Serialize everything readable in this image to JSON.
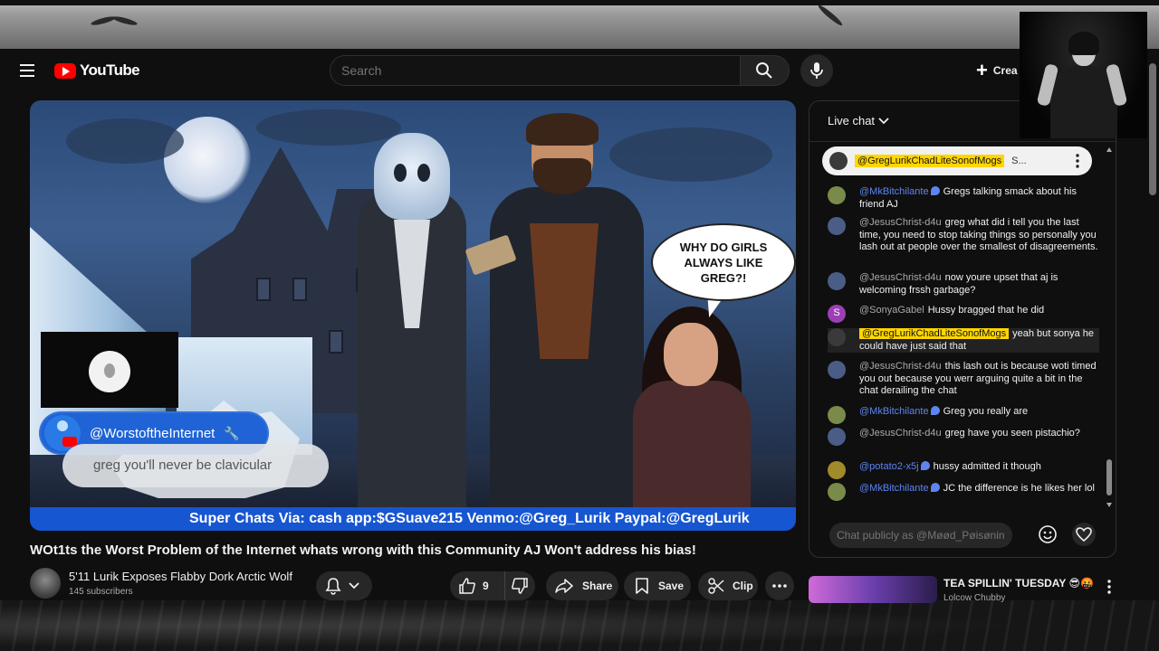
{
  "masthead": {
    "logo_text": "YouTube",
    "search_placeholder": "Search",
    "create_label": "Crea"
  },
  "player": {
    "speech_bubble": "WHY DO GIRLS ALWAYS LIKE GREG?!",
    "overlay_channel": "@WorstoftheInternet",
    "caption": "greg you'll never be clavicular",
    "superchat_banner": "Super Chats Via: cash app:$GSuave215 Venmo:@Greg_Lurik Paypal:@GregLurik"
  },
  "video": {
    "title": "WOt1ts the Worst Problem of the Internet whats wrong with this Community AJ Won't address his bias!",
    "channel_name": "5'11 Lurik Exposes Flabby Dork Arctic Wolf",
    "subscribers": "145 subscribers",
    "like_count": "9",
    "share_label": "Share",
    "save_label": "Save",
    "clip_label": "Clip"
  },
  "chat": {
    "header": "Live chat",
    "pinned": {
      "author": "@GregLurikChadLiteSonofMogs",
      "text": "S..."
    },
    "messages": [
      {
        "author": "@MkBitchilante",
        "text": "Gregs talking smack about his friend AJ",
        "style": "mod",
        "avatar_color": "#7a8a4a"
      },
      {
        "author": "@JesusChrist-d4u",
        "text": "greg what did i tell you the last time, you need to stop taking things so personally you lash out at people over the smallest of disagreements.",
        "style": "normal",
        "avatar_color": "#4a5d86"
      },
      {
        "author": "@JesusChrist-d4u",
        "text": "now youre upset that aj is welcoming frssh garbage?",
        "style": "normal",
        "avatar_color": "#4a5d86"
      },
      {
        "author": "@SonyaGabel",
        "text": "Hussy bragged that he did",
        "style": "normal",
        "avatar_color": "#9c3fb5",
        "avatar_letter": "S"
      },
      {
        "author": "@GregLurikChadLiteSonofMogs",
        "text": "yeah but sonya he could have just said that",
        "style": "highlight",
        "avatar_color": "#3a3a3a"
      },
      {
        "author": "@JesusChrist-d4u",
        "text": "this lash out is because woti timed you out because you werr arguing quite a bit in the chat derailing the chat",
        "style": "normal",
        "avatar_color": "#4a5d86"
      },
      {
        "author": "@MkBitchilante",
        "text": "Greg you really are",
        "style": "mod",
        "avatar_color": "#7a8a4a"
      },
      {
        "author": "@JesusChrist-d4u",
        "text": "greg have you seen pistachio?",
        "style": "normal",
        "avatar_color": "#4a5d86"
      },
      {
        "author": "@potato2-x5j",
        "text": "hussy admitted it though",
        "style": "mod",
        "avatar_color": "#a08a2a"
      },
      {
        "author": "@MkBitchilante",
        "text": "JC the difference is he likes her lol",
        "style": "mod",
        "avatar_color": "#7a8a4a"
      }
    ],
    "input_placeholder": "Chat publicly as @Møød_Pøisøning..."
  },
  "up_next": {
    "title": "TEA SPILLIN' TUESDAY 😎🤬",
    "channel": "Lolcow Chubby"
  },
  "colors": {
    "background": "#0f0f0f",
    "brand_red": "#ff0000",
    "superchat_blue": "#1756d1",
    "highlight_yellow": "#ffd600",
    "mod_blue": "#5e84f1"
  }
}
